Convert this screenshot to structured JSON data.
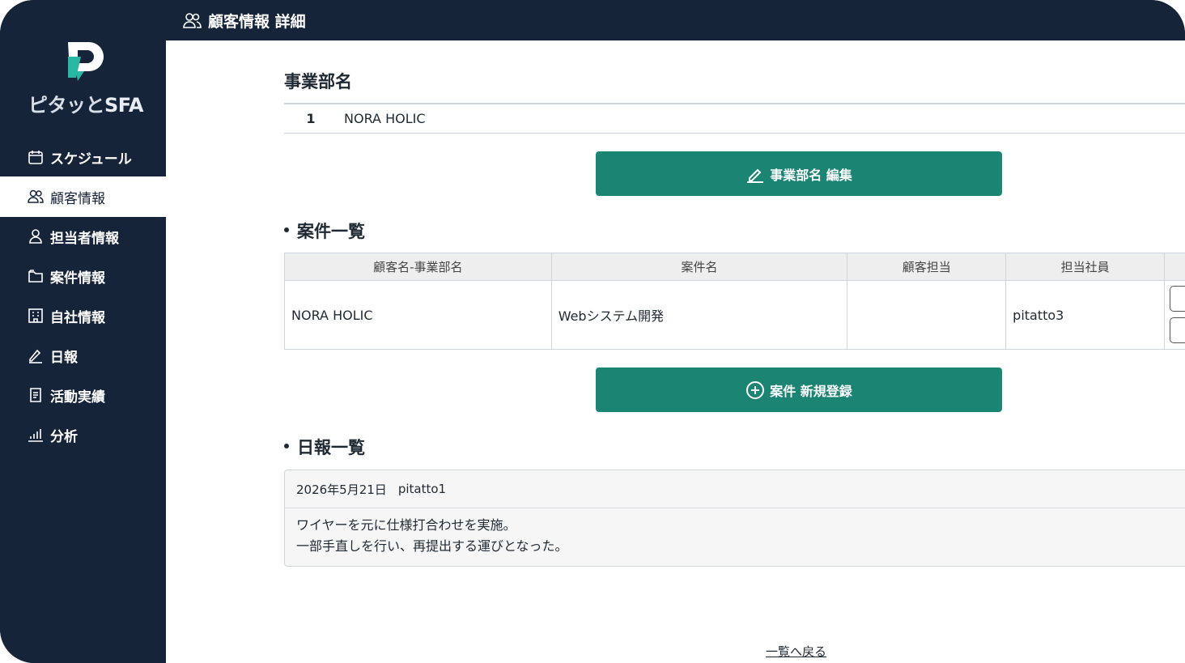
{
  "brand": {
    "logo_text": "ピタッと",
    "logo_sfa": "SFA"
  },
  "header": {
    "title": "顧客情報 詳細"
  },
  "sidebar": {
    "items": [
      {
        "label": "スケジュール",
        "icon": "calendar-icon"
      },
      {
        "label": "顧客情報",
        "icon": "users-icon",
        "active": true
      },
      {
        "label": "担当者情報",
        "icon": "user-icon"
      },
      {
        "label": "案件情報",
        "icon": "folder-icon"
      },
      {
        "label": "自社情報",
        "icon": "building-icon"
      },
      {
        "label": "日報",
        "icon": "pen-icon"
      },
      {
        "label": "活動実績",
        "icon": "document-icon"
      },
      {
        "label": "分析",
        "icon": "bar-chart-icon"
      }
    ]
  },
  "department": {
    "heading": "事業部名",
    "rows": [
      {
        "no": "1",
        "name": "NORA HOLIC"
      }
    ],
    "edit_button": "事業部名 編集"
  },
  "projects": {
    "heading": "案件一覧",
    "columns": [
      "顧客名-事業部名",
      "案件名",
      "顧客担当",
      "担当社員"
    ],
    "rows": [
      {
        "customer": "NORA HOLIC",
        "project": "Webシステム開発",
        "contact": "",
        "staff": "pitatto3"
      }
    ],
    "new_button": "案件 新規登録"
  },
  "reports": {
    "heading": "日報一覧",
    "items": [
      {
        "date": "2026年5月21日",
        "author": "pitatto1",
        "line1": "ワイヤーを元に仕様打合わせを実施。",
        "line2": "一部手直しを行い、再提出する運びとなった。"
      }
    ]
  },
  "footer": {
    "back_link": "一覧へ戻る"
  },
  "colors": {
    "sidebar": "#16243a",
    "accent": "#1b8472"
  }
}
